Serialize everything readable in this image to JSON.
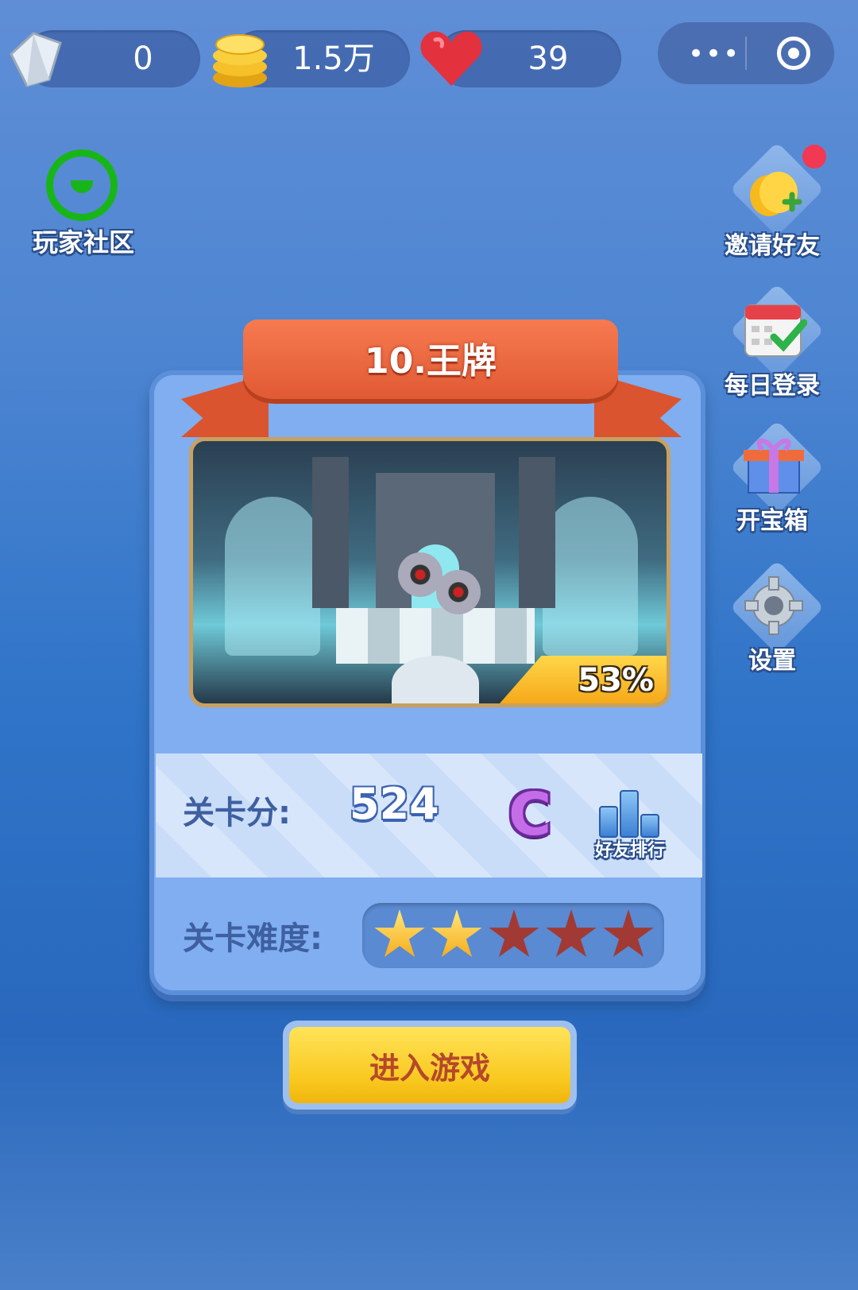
{
  "topbar": {
    "diamonds": "0",
    "coins": "1.5万",
    "hearts": "39"
  },
  "capsule": {
    "more_label": "•••"
  },
  "community": {
    "label": "玩家社区"
  },
  "side_menu": {
    "invite": "邀请好友",
    "daily": "每日登录",
    "chest": "开宝箱",
    "settings": "设置"
  },
  "level": {
    "title": "10.王牌",
    "progress": "53%",
    "score_label": "关卡分:",
    "score": "524",
    "grade": "C",
    "rank_label": "好友排行",
    "difficulty_label": "关卡难度:",
    "difficulty_stars": 2,
    "difficulty_max": 5
  },
  "play_button": "进入游戏",
  "colors": {
    "accent_yellow": "#f9c81e",
    "ribbon_red": "#e05a34",
    "grade_purple": "#c56de8",
    "community_green": "#18b518"
  }
}
